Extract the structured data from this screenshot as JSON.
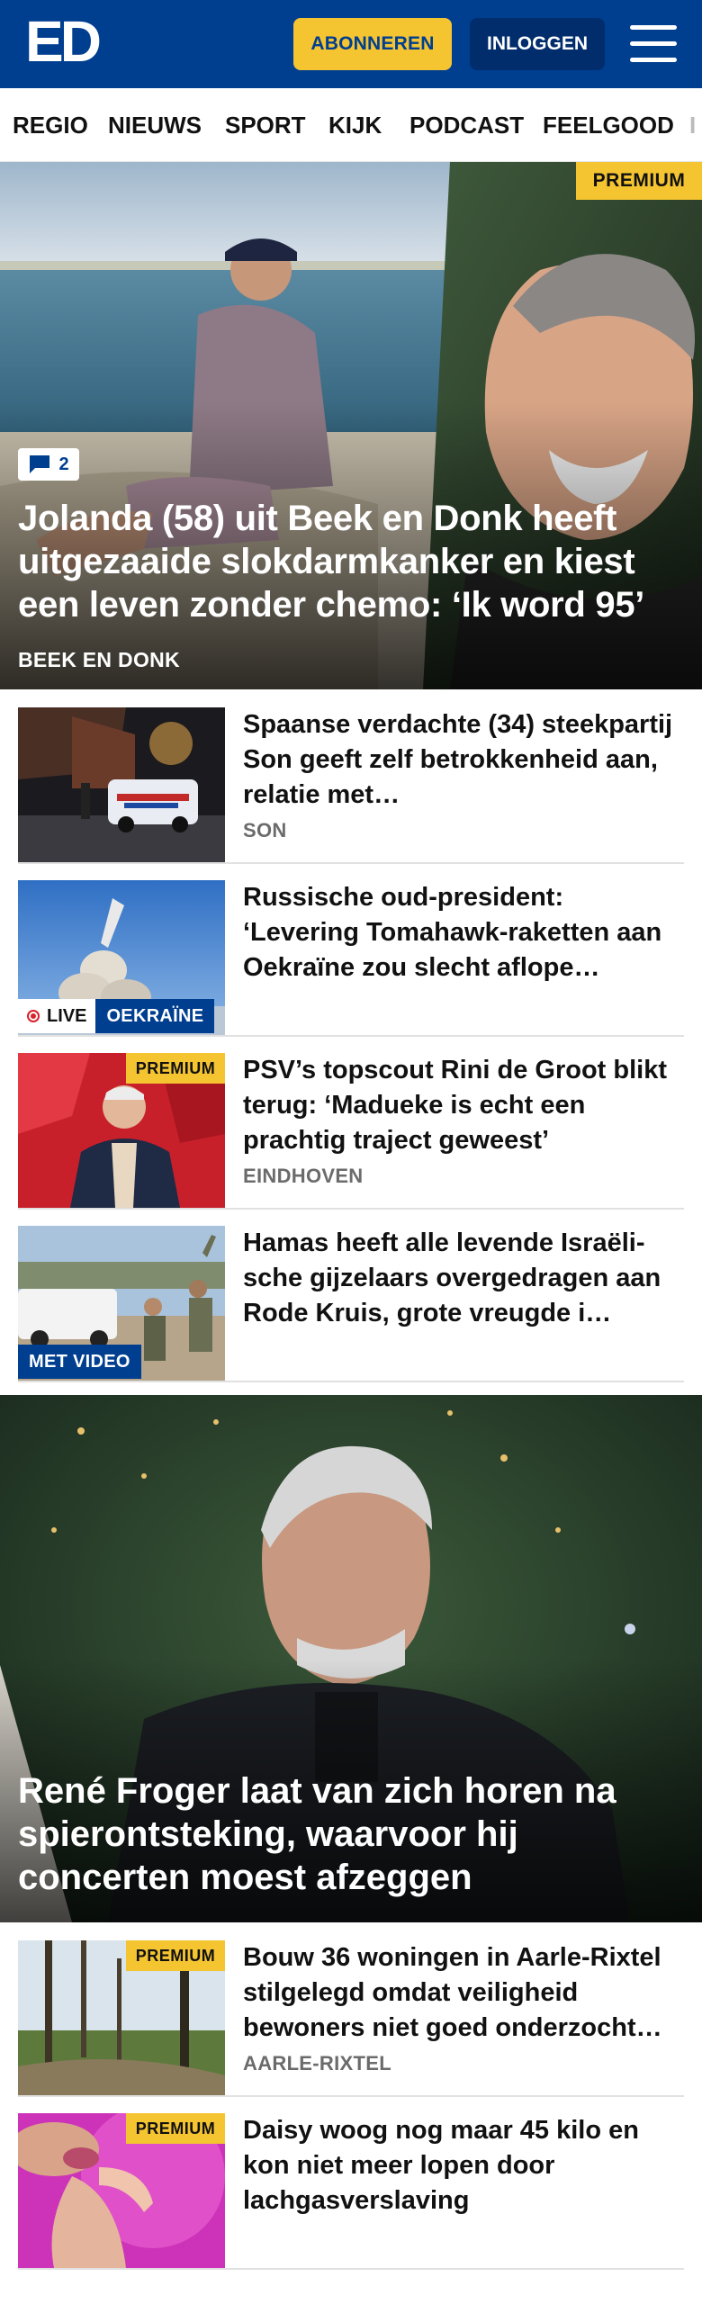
{
  "header": {
    "logo": "ED",
    "subscribe_label": "ABONNEREN",
    "login_label": "INLOGGEN"
  },
  "nav": {
    "items": [
      "REGIO",
      "NIEUWS",
      "SPORT",
      "KIJK",
      "PODCAST",
      "FEELGOOD",
      "I"
    ]
  },
  "hero": {
    "premium_label": "PREMIUM",
    "comment_count": "2",
    "title": "Jolanda (58) uit Beek en Donk heeft uitgezaaide slokdarmkanker en kiest een leven zonder chemo: ‘Ik word 95’",
    "place": "BEEK EN DONK"
  },
  "articles": [
    {
      "title": "Spaanse verdachte (34) steekpartij Son geeft zelf betrokkenheid aan, relatie met…",
      "place": "SON"
    },
    {
      "title": "Russische oud-president: ‘Levering Tomahawk-raketten aan Oekraïne zou slecht aflope…",
      "live_label": "LIVE",
      "topic_label": "OEKRAÏNE"
    },
    {
      "title": "PSV’s topscout Rini de Groot blikt terug: ‘Madueke is echt een prachtig traject geweest’",
      "place": "EINDHOVEN",
      "premium_label": "PREMIUM"
    },
    {
      "title": "Hamas heeft alle levende Israëli­sche gijzelaars overgedragen aan Rode Kruis, grote vreugde i…",
      "video_label": "MET VIDEO"
    }
  ],
  "hero2": {
    "title": "René Froger laat van zich horen na spierontsteking, waarvoor hij concerten moest afzeggen"
  },
  "articles2": [
    {
      "title": "Bouw 36 woningen in Aarle-Rix­tel stilgelegd omdat veiligheid bewoners niet goed onderzocht…",
      "place": "AARLE-RIXTEL",
      "premium_label": "PREMIUM"
    },
    {
      "title": "Daisy woog nog maar 45 kilo en kon niet meer lopen door lachgasverslaving",
      "premium_label": "PREMIUM"
    }
  ],
  "colors": {
    "brand_blue": "#003e90",
    "premium_yellow": "#f4c431",
    "live_red": "#d8232a"
  }
}
